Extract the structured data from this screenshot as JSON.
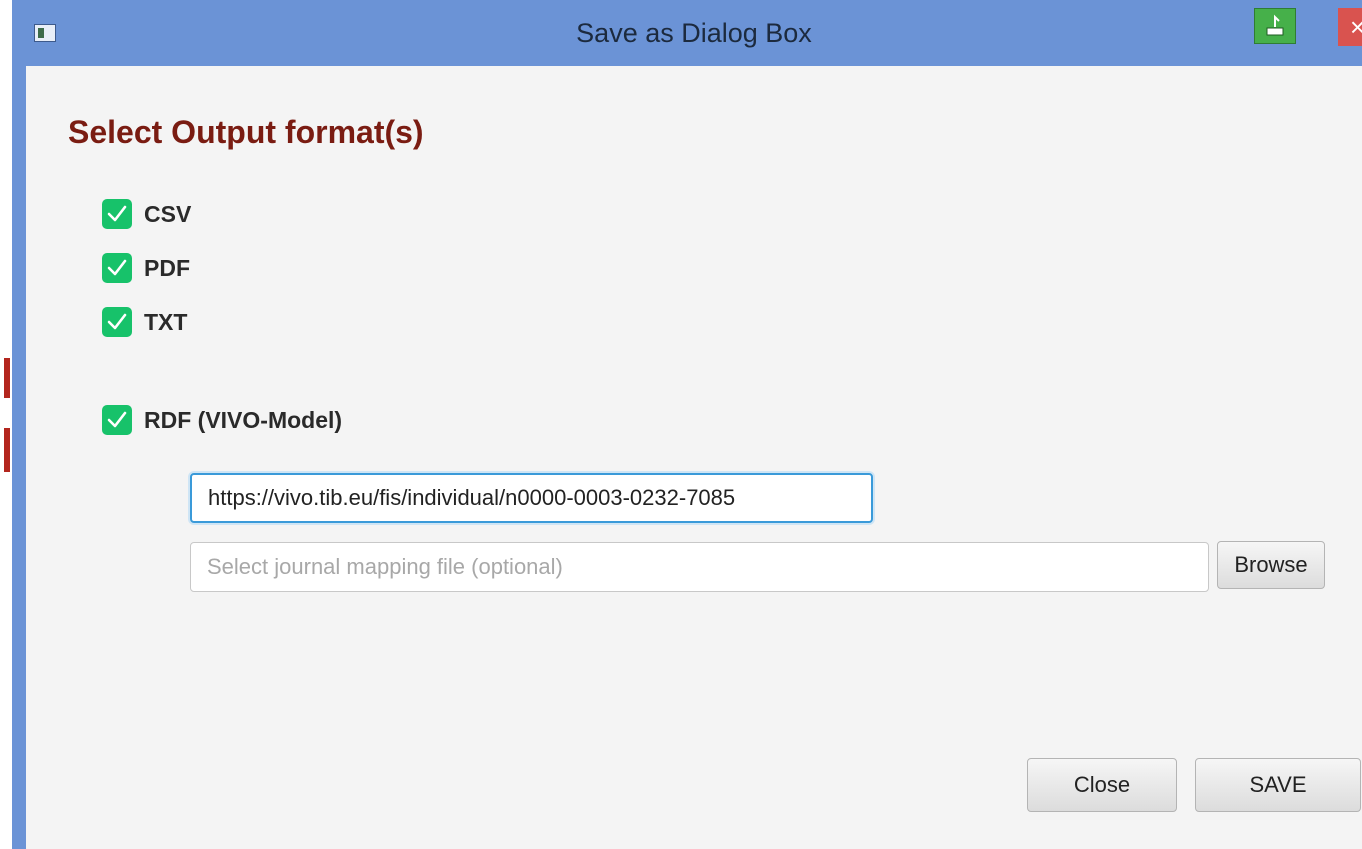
{
  "window": {
    "title": "Save as Dialog Box",
    "close_glyph": "×",
    "app_icon": "app-window-icon",
    "pin_icon": "pin-icon"
  },
  "heading": "Select Output format(s)",
  "formats": [
    {
      "label": "CSV",
      "checked": true
    },
    {
      "label": "PDF",
      "checked": true
    },
    {
      "label": "TXT",
      "checked": true
    },
    {
      "label": "RDF (VIVO-Model)",
      "checked": true
    }
  ],
  "rdf": {
    "uri_value": "https://vivo.tib.eu/fis/individual/n0000-0003-0232-7085",
    "mapping_placeholder": "Select journal mapping file (optional)",
    "browse_label": "Browse"
  },
  "buttons": {
    "close_label": "Close",
    "save_label": "SAVE"
  },
  "colors": {
    "titlebar": "#6b93d6",
    "heading": "#7a1c12",
    "checkbox": "#17c26a",
    "focus_border": "#3a9ad9"
  }
}
